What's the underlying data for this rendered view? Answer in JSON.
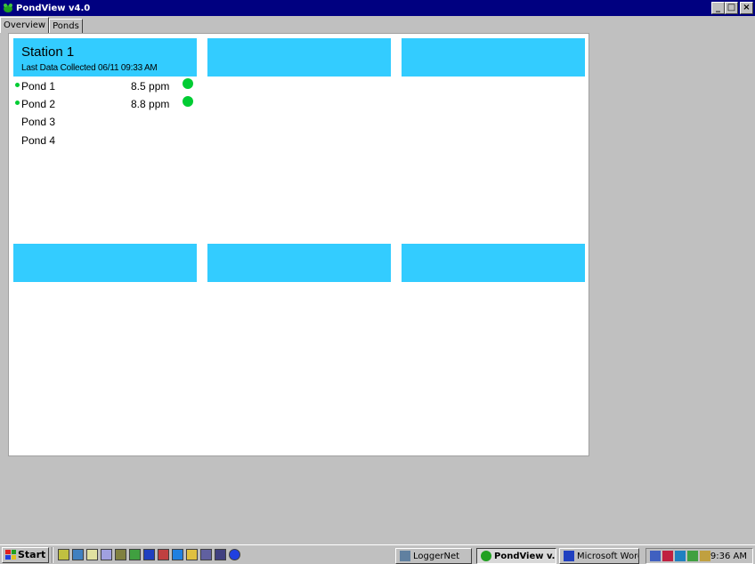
{
  "window": {
    "title": "PondView v4.0",
    "buttons": {
      "minimize": "_",
      "maximize": "□",
      "close": "×"
    }
  },
  "tabs": [
    {
      "label": "Overview",
      "active": true
    },
    {
      "label": "Ponds",
      "active": false
    }
  ],
  "stations": [
    {
      "title": "Station 1",
      "subtitle": "Last Data Collected 06/11 09:33 AM",
      "ponds": [
        {
          "name": "Pond 1",
          "value": "8.5 ppm",
          "active": true
        },
        {
          "name": "Pond 2",
          "value": "8.8 ppm",
          "active": true
        },
        {
          "name": "Pond 3",
          "value": "",
          "active": false
        },
        {
          "name": "Pond 4",
          "value": "",
          "active": false
        }
      ]
    },
    {
      "title": "",
      "subtitle": "",
      "ponds": []
    },
    {
      "title": "",
      "subtitle": "",
      "ponds": []
    },
    {
      "title": "",
      "subtitle": "",
      "ponds": []
    },
    {
      "title": "",
      "subtitle": "",
      "ponds": []
    },
    {
      "title": "",
      "subtitle": "",
      "ponds": []
    }
  ],
  "colors": {
    "station_header": "#33ccff",
    "status_ok": "#00cc33"
  },
  "taskbar": {
    "start_label": "Start",
    "quick_launch_icons": [
      "app-icon",
      "edit-icon",
      "search-icon",
      "window-icon",
      "tool-icon",
      "settings-icon",
      "monitor-icon",
      "app-icon",
      "browser-icon",
      "app-icon",
      "app-icon",
      "window-icon",
      "arrow-icon"
    ],
    "tasks": [
      {
        "label": "LoggerNet",
        "icon": "loggernet-icon",
        "active": false
      },
      {
        "label": "PondView v...",
        "icon": "pondview-icon",
        "active": true
      },
      {
        "label": "Microsoft Word ...",
        "icon": "word-icon",
        "active": false
      }
    ],
    "tray_icons": [
      "network-icon",
      "shield-icon",
      "display-icon",
      "app-icon",
      "speaker-icon"
    ],
    "clock": "9:36 AM"
  }
}
